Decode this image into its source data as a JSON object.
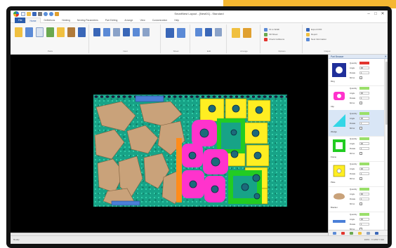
{
  "window": {
    "title": "SmartNest Layout - [Nest01] - Standard"
  },
  "title_controls": [
    "–",
    "□",
    "✕"
  ],
  "tabs": [
    "File",
    "Home",
    "Definitions",
    "Nesting",
    "Nesting Parameters",
    "Part Editing",
    "Arrange",
    "View",
    "Customization",
    "Help"
  ],
  "ribbon_groups": [
    "Parts",
    "Nest",
    "Sheet",
    "Edit",
    "Arrange",
    "Options",
    "Output"
  ],
  "ribbon_text": {
    "options": [
      "Fit to Width",
      "Fill Sheet",
      "Check Collisions"
    ],
    "output": [
      "Export DXF",
      "Report",
      "Nest Information"
    ]
  },
  "panel": {
    "title": "Part Browser",
    "pin": "✕",
    "items": [
      {
        "name": "Ring",
        "qty_label": "Quantity",
        "angle_label": "Angle",
        "rotate_label": "Rotate",
        "mirror_label": "Mirror",
        "angle": "90",
        "rotate": "1",
        "color": "#1f2f9a",
        "selected": false
      },
      {
        "name": "Clip",
        "qty_label": "Quantity",
        "angle_label": "Angle",
        "rotate_label": "Rotate",
        "mirror_label": "Mirror",
        "angle": "90",
        "rotate": "1",
        "color": "#ff33cc",
        "selected": false
      },
      {
        "name": "Wedge",
        "qty_label": "Quantity",
        "angle_label": "Angle",
        "rotate_label": "Rotate",
        "mirror_label": "Mirror",
        "angle": "90",
        "rotate": "1",
        "color": "#33d6e6",
        "selected": true
      },
      {
        "name": "Frame",
        "qty_label": "Quantity",
        "angle_label": "Angle",
        "rotate_label": "Rotate",
        "mirror_label": "Mirror",
        "angle": "90",
        "rotate": "1",
        "color": "#22cc22",
        "selected": false
      },
      {
        "name": "Plate",
        "qty_label": "Quantity",
        "angle_label": "Angle",
        "rotate_label": "Rotate",
        "mirror_label": "Mirror",
        "angle": "90",
        "rotate": "1",
        "color": "#ffee22",
        "selected": false
      },
      {
        "name": "Bracket",
        "qty_label": "Quantity",
        "angle_label": "Angle",
        "rotate_label": "Rotate",
        "mirror_label": "Mirror",
        "angle": "90",
        "rotate": "1",
        "color": "#c9a27a",
        "selected": false
      },
      {
        "name": "Bar",
        "qty_label": "Quantity",
        "angle_label": "Angle",
        "rotate_label": "Rotate",
        "mirror_label": "Mirror",
        "angle": "90",
        "rotate": "1",
        "color": "#4a7fd8",
        "selected": false
      }
    ]
  },
  "status": {
    "left": "Ready",
    "right": "100%  ·  X 1250  Y 610"
  },
  "colors": {
    "accent": "#f5b731",
    "board": "#17a387",
    "tan": "#c9a27a",
    "magenta": "#ff33cc",
    "yellow": "#ffee22",
    "green": "#22cc22",
    "orange": "#ff8c1a",
    "blue": "#4a7fd8"
  }
}
